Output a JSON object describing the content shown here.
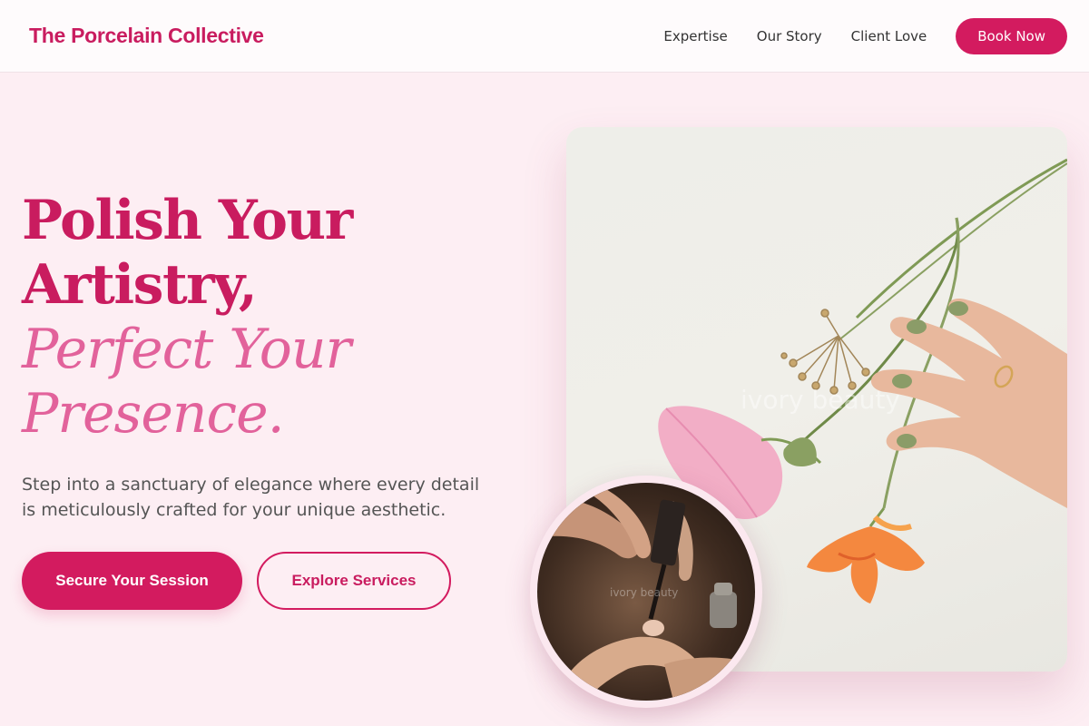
{
  "header": {
    "brand": "The Porcelain Collective",
    "nav": [
      {
        "label": "Expertise"
      },
      {
        "label": "Our Story"
      },
      {
        "label": "Client Love"
      }
    ],
    "cta": "Book Now"
  },
  "hero": {
    "title_line1": "Polish Your",
    "title_line2": "Artistry,",
    "title_line3": "Perfect Your",
    "title_line4": "Presence.",
    "subtitle": "Step into a sanctuary of elegance where every detail is meticulously crafted for your unique aesthetic.",
    "primary_cta": "Secure Your Session",
    "secondary_cta": "Explore Services"
  },
  "images": {
    "main_watermark": "ivory beauty",
    "circle_watermark": "ivory beauty"
  },
  "colors": {
    "brand": "#c91c5f",
    "accent_light": "#e2629b",
    "background": "#fdeef3"
  }
}
